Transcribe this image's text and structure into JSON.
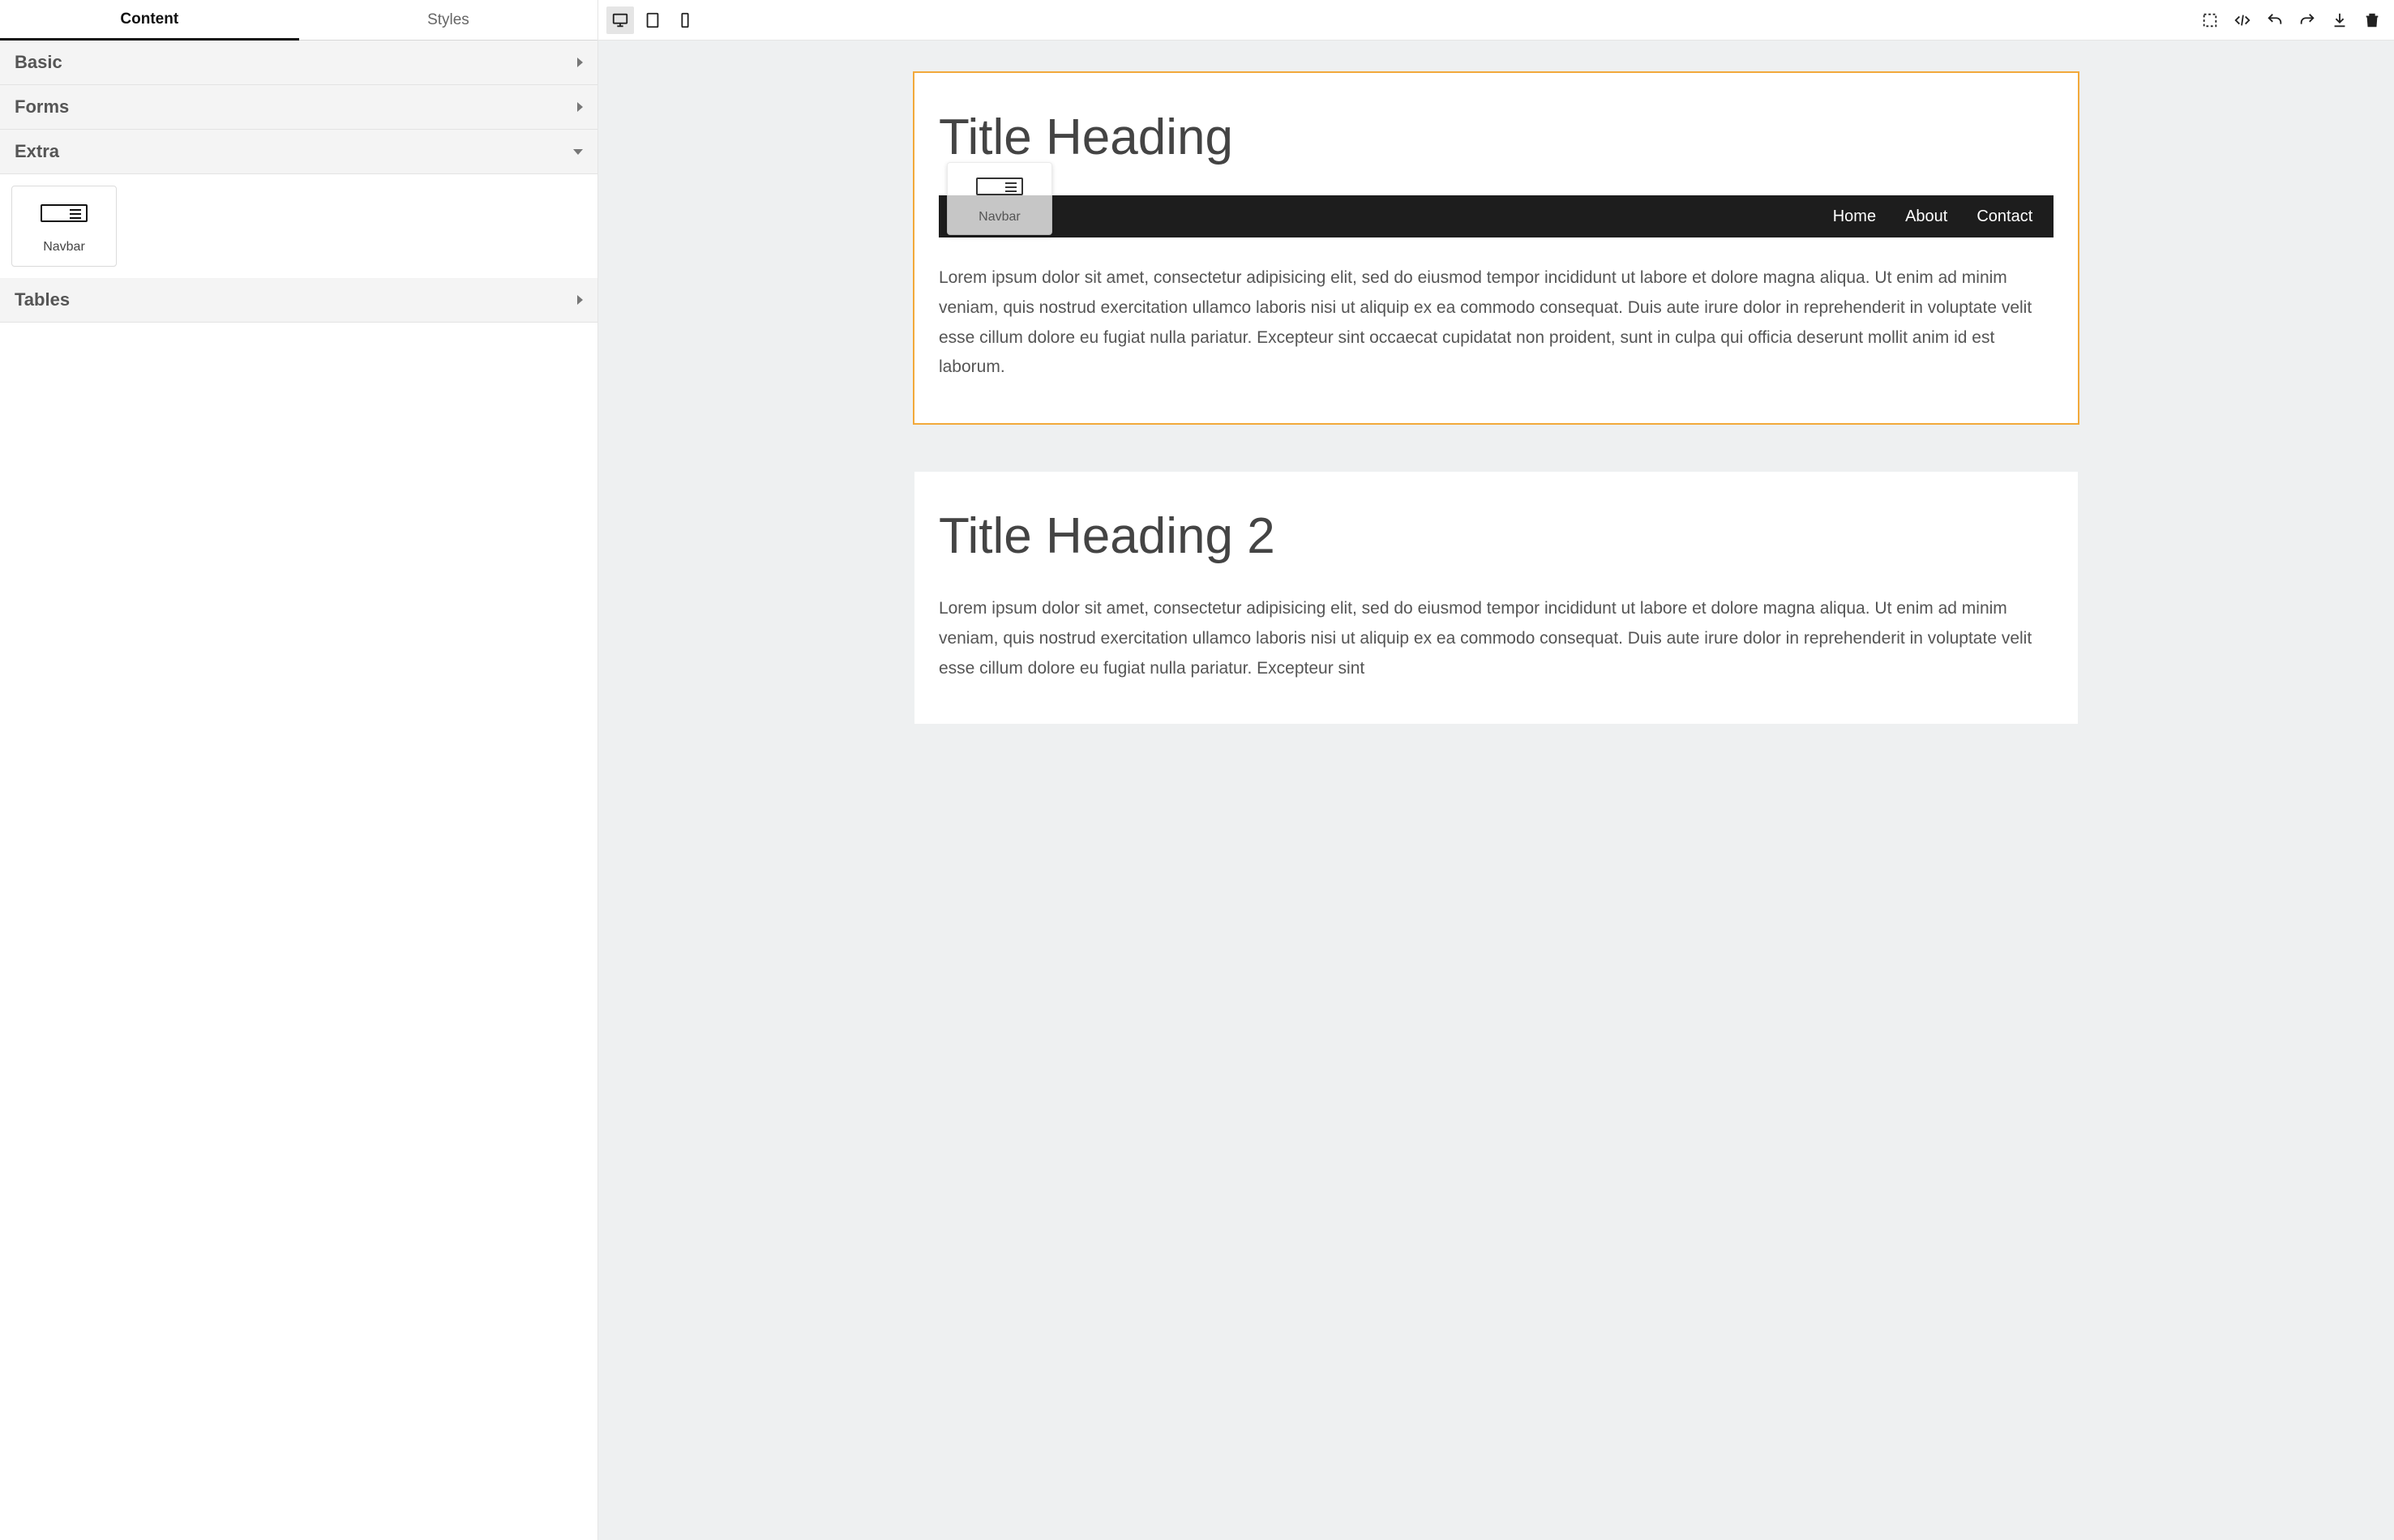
{
  "sidebar": {
    "tabs": {
      "content": "Content",
      "styles": "Styles",
      "active": "content"
    },
    "sections": [
      {
        "id": "basic",
        "label": "Basic",
        "expanded": false
      },
      {
        "id": "forms",
        "label": "Forms",
        "expanded": false
      },
      {
        "id": "extra",
        "label": "Extra",
        "expanded": true
      },
      {
        "id": "tables",
        "label": "Tables",
        "expanded": false
      }
    ],
    "extra_blocks": [
      {
        "id": "navbar",
        "label": "Navbar",
        "icon": "navbar-icon"
      }
    ]
  },
  "toolbar": {
    "devices": {
      "desktop": "desktop-icon",
      "tablet": "tablet-icon",
      "mobile": "mobile-icon",
      "active": "desktop"
    },
    "actions": {
      "select_marquee": "select-marquee-icon",
      "code": "code-icon",
      "undo": "undo-icon",
      "redo": "redo-icon",
      "download": "download-icon",
      "delete": "trash-icon"
    }
  },
  "canvas": {
    "drag_ghost": {
      "visible": true,
      "label": "Navbar"
    },
    "cards": [
      {
        "id": "card1",
        "selected": true,
        "title": "Title Heading",
        "navbar": {
          "items": [
            "Home",
            "About",
            "Contact"
          ]
        },
        "body": "Lorem ipsum dolor sit amet, consectetur adipisicing elit, sed do eiusmod tempor incididunt ut labore et dolore magna aliqua. Ut enim ad minim veniam, quis nostrud exercitation ullamco laboris nisi ut aliquip ex ea commodo consequat. Duis aute irure dolor in reprehenderit in voluptate velit esse cillum dolore eu fugiat nulla pariatur. Excepteur sint occaecat cupidatat non proident, sunt in culpa qui officia deserunt mollit anim id est laborum."
      },
      {
        "id": "card2",
        "selected": false,
        "title": "Title Heading 2",
        "body": "Lorem ipsum dolor sit amet, consectetur adipisicing elit, sed do eiusmod tempor incididunt ut labore et dolore magna aliqua. Ut enim ad minim veniam, quis nostrud exercitation ullamco laboris nisi ut aliquip ex ea commodo consequat. Duis aute irure dolor in reprehenderit in voluptate velit esse cillum dolore eu fugiat nulla pariatur. Excepteur sint"
      }
    ]
  }
}
